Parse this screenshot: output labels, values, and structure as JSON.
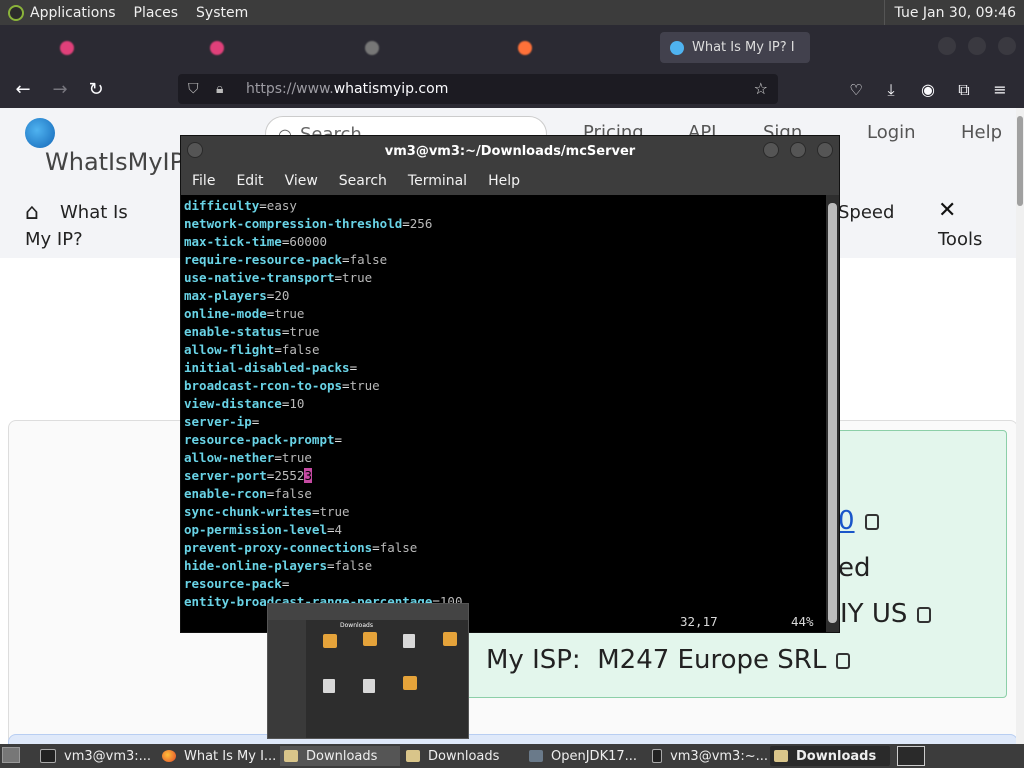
{
  "top_panel": {
    "menus": [
      "Applications",
      "Places",
      "System"
    ],
    "clock": "Tue Jan 30, 09:46"
  },
  "browser": {
    "tabs": [
      {
        "label": "",
        "active": false,
        "color": "#e0407a"
      },
      {
        "label": "",
        "active": false,
        "color": "#e0407a"
      },
      {
        "label": "",
        "active": false,
        "color": "#777777"
      },
      {
        "label": "",
        "active": false,
        "color": "#ff7139"
      },
      {
        "label": "What Is My IP? I",
        "active": true,
        "color": "#4fb3f0"
      }
    ],
    "url_prefix": "https://www.",
    "url_domain": "whatismyip.com"
  },
  "site": {
    "logo_text": "WhatIsMyIP.c",
    "search_placeholder": "Search",
    "nav": [
      "Pricing",
      "API",
      "Sign",
      "Login",
      "Help"
    ],
    "menu_whatis_1": "What Is",
    "menu_whatis_2": "My IP?",
    "menu_speed": "Speed",
    "menu_tools": "Tools",
    "info_ip_fragment": "0",
    "info_fragment_2": "ed",
    "info_fragment_3": "IY US",
    "isp_label": "My ISP:",
    "isp_value": "M247 Europe SRL"
  },
  "terminal": {
    "title": "vm3@vm3:~/Downloads/mcServer",
    "menu": [
      "File",
      "Edit",
      "View",
      "Search",
      "Terminal",
      "Help"
    ],
    "lines": [
      {
        "key": "difficulty",
        "value": "easy"
      },
      {
        "key": "network-compression-threshold",
        "value": "256"
      },
      {
        "key": "max-tick-time",
        "value": "60000"
      },
      {
        "key": "require-resource-pack",
        "value": "false"
      },
      {
        "key": "use-native-transport",
        "value": "true"
      },
      {
        "key": "max-players",
        "value": "20"
      },
      {
        "key": "online-mode",
        "value": "true"
      },
      {
        "key": "enable-status",
        "value": "true"
      },
      {
        "key": "allow-flight",
        "value": "false"
      },
      {
        "key": "initial-disabled-packs",
        "value": ""
      },
      {
        "key": "broadcast-rcon-to-ops",
        "value": "true"
      },
      {
        "key": "view-distance",
        "value": "10"
      },
      {
        "key": "server-ip",
        "value": ""
      },
      {
        "key": "resource-pack-prompt",
        "value": ""
      },
      {
        "key": "allow-nether",
        "value": "true"
      },
      {
        "key": "server-port",
        "value": "2552",
        "cursor": "3"
      },
      {
        "key": "enable-rcon",
        "value": "false"
      },
      {
        "key": "sync-chunk-writes",
        "value": "true"
      },
      {
        "key": "op-permission-level",
        "value": "4"
      },
      {
        "key": "prevent-proxy-connections",
        "value": "false"
      },
      {
        "key": "hide-online-players",
        "value": "false"
      },
      {
        "key": "resource-pack",
        "value": ""
      },
      {
        "key": "entity-broadcast-range-percentage",
        "value": "100"
      }
    ],
    "status_pos": "32,17",
    "status_pct": "44%",
    "scroll_fraction": 0.44
  },
  "thumbnail": {
    "title": "Downloads"
  },
  "taskbar": {
    "items": [
      {
        "label": "vm3@vm3:...",
        "icon": "terminal-icon",
        "active": false
      },
      {
        "label": "What Is My I...",
        "icon": "firefox-icon",
        "active": false
      },
      {
        "label": "Downloads",
        "icon": "folder-icon",
        "active": false
      },
      {
        "label": "Downloads",
        "icon": "folder-icon",
        "active": false
      },
      {
        "label": "OpenJDK17...",
        "icon": "java-icon",
        "active": false
      },
      {
        "label": "vm3@vm3:~...",
        "icon": "terminal-icon",
        "active": false
      },
      {
        "label": "Downloads",
        "icon": "folder-icon",
        "active": true
      }
    ]
  }
}
